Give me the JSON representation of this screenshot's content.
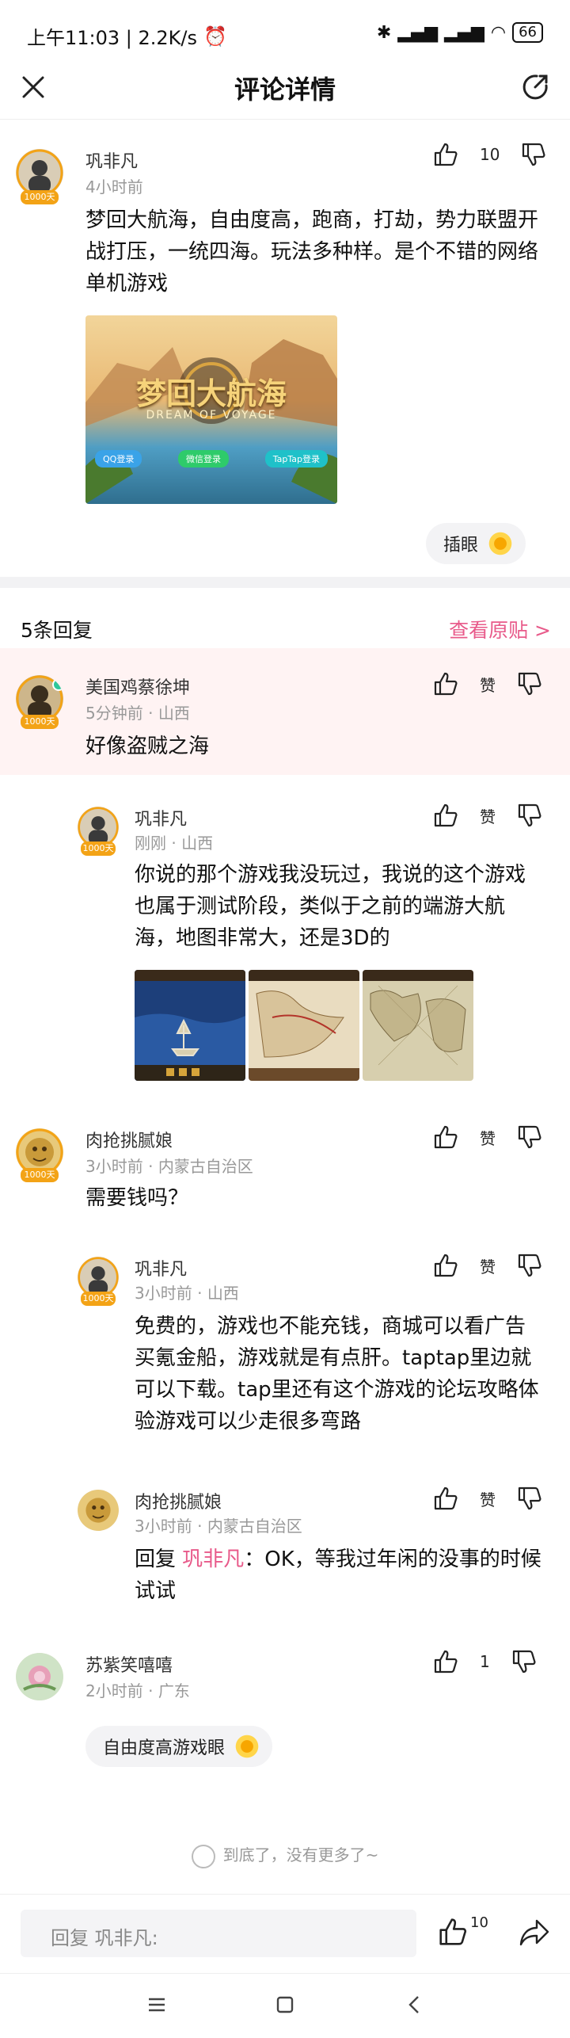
{
  "status": {
    "time_speed": "上午11:03 | 2.2K/s",
    "battery": "66"
  },
  "header": {
    "title": "评论详情"
  },
  "main_comment": {
    "author": "巩非凡",
    "time": "4小时前",
    "like_count": "10",
    "badge": "1000天",
    "text": "梦回大航海，自由度高，跑商，打劫，势力联盟开战打压，一统四海。玩法多种样。是个不错的网络单机游戏",
    "image_title": "梦回大航海",
    "image_subtitle": "DREAM OF VOYAGE",
    "image_buttons": [
      "QQ登录",
      "微信登录",
      "TapTap登录"
    ],
    "tag": "插眼"
  },
  "replies_header": {
    "count": "5条回复",
    "view_original": "查看原贴 >"
  },
  "replies": [
    {
      "author": "美国鸡蔡徐坤",
      "time": "5分钟前",
      "region": "山西",
      "like_label": "赞",
      "text": "好像盗贼之海",
      "badge": "1000天"
    },
    {
      "author": "巩非凡",
      "time": "刚刚",
      "region": "山西",
      "like_label": "赞",
      "text": "你说的那个游戏我没玩过，我说的这个游戏也属于测试阶段，类似于之前的端游大航海，地图非常大，还是3D的",
      "badge": "1000天"
    },
    {
      "author": "肉抢挑腻娘",
      "time": "3小时前",
      "region": "内蒙古自治区",
      "like_label": "赞",
      "text": "需要钱吗？",
      "badge": "1000天"
    },
    {
      "author": "巩非凡",
      "time": "3小时前",
      "region": "山西",
      "like_label": "赞",
      "text": "免费的，游戏也不能充钱，商城可以看广告买氪金船，游戏就是有点肝。taptap里边就可以下载。tap里还有这个游戏的论坛攻略体验游戏可以少走很多弯路",
      "badge": "1000天"
    },
    {
      "author": "肉抢挑腻娘",
      "time": "3小时前",
      "region": "内蒙古自治区",
      "like_label": "赞",
      "reply_prefix": "回复",
      "reply_to": "巩非凡",
      "text": "：OK，等我过年闲的没事的时候试试"
    },
    {
      "author": "苏紫笑嘻嘻",
      "time": "2小时前",
      "region": "广东",
      "like_label": "1",
      "tag": "自由度高游戏眼"
    }
  ],
  "footer": {
    "end_text": "到底了，没有更多了~",
    "reply_placeholder": "回复 巩非凡:",
    "bottom_like_count": "10"
  },
  "colors": {
    "accent_pink": "#e85a8a",
    "highlight_bg": "#fff3f3"
  }
}
